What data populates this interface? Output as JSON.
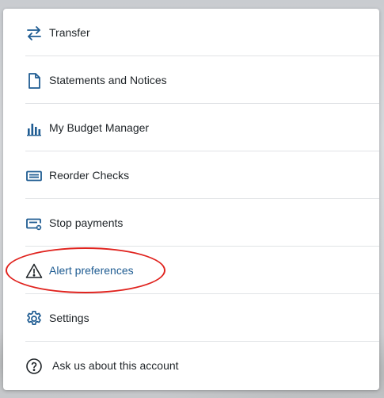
{
  "menu": {
    "items": [
      {
        "label": "Transfer",
        "icon": "transfer-arrows-icon"
      },
      {
        "label": "Statements and Notices",
        "icon": "document-icon"
      },
      {
        "label": "My Budget Manager",
        "icon": "bar-chart-icon"
      },
      {
        "label": "Reorder Checks",
        "icon": "check-card-icon"
      },
      {
        "label": "Stop payments",
        "icon": "stop-payment-card-icon"
      },
      {
        "label": "Alert preferences",
        "icon": "warning-triangle-icon"
      },
      {
        "label": "Settings",
        "icon": "gear-icon"
      },
      {
        "label": "Ask us about this account",
        "icon": "question-circle-icon"
      }
    ]
  },
  "colors": {
    "icon": "#1f5c92",
    "text": "#1f2428",
    "active_text": "#1f5c92",
    "highlight": "#e0231e"
  }
}
